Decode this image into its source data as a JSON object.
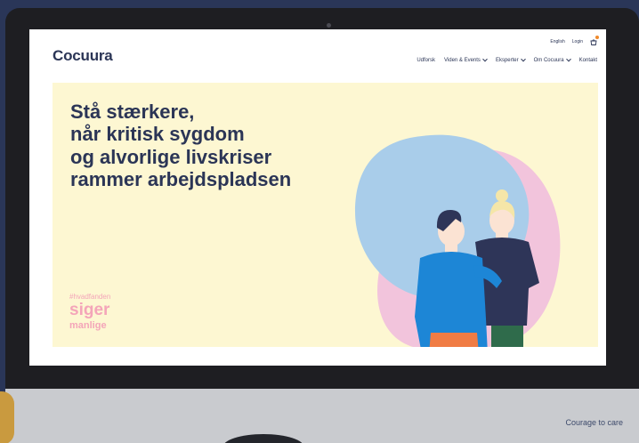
{
  "header": {
    "logo_text": "ocuura",
    "logo_mark": "C",
    "utility": {
      "language": "English",
      "login": "Login"
    }
  },
  "nav": {
    "items": [
      {
        "label": "Udforsk",
        "has_menu": false
      },
      {
        "label": "Viden & Events",
        "has_menu": true
      },
      {
        "label": "Eksperter",
        "has_menu": true
      },
      {
        "label": "Om Cocuura",
        "has_menu": true
      },
      {
        "label": "Kontakt",
        "has_menu": false
      }
    ]
  },
  "hero": {
    "headline_lines": [
      "Stå stærkere,",
      "når kritisk sygdom",
      "og alvorlige livskriser",
      "rammer arbejdspladsen"
    ],
    "hashtag": "#hvadfanden",
    "tag_big": "siger",
    "tag_mid": "manlige"
  },
  "footer": {
    "tagline": "Courage to care"
  },
  "colors": {
    "brand_navy": "#2b3556",
    "hero_bg": "#fdf7d2",
    "accent_pink": "#f4a5b9",
    "accent_orange": "#f08a2c",
    "blob_blue": "#a9cdea",
    "blob_pink": "#f2c4dc"
  },
  "icons": {
    "basket": "basket-icon"
  }
}
